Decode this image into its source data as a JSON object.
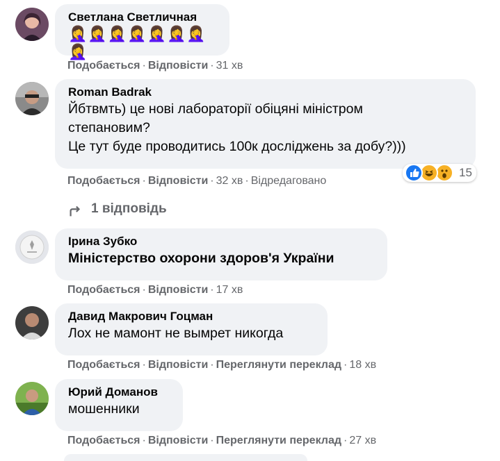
{
  "comments": [
    {
      "author": "Светлана Светличная",
      "text": "🤦‍♀️🤦‍♀️🤦‍♀️🤦‍♀️🤦‍♀️🤦‍♀️🤦‍♀️🤦‍♀️",
      "like": "Подобається",
      "reply": "Відповісти",
      "time": "31 хв"
    },
    {
      "author": "Roman Badrak",
      "text_lines": [
        "Йбтвмть) це нові лабораторії обіцяні міністром",
        "степановим?",
        "Це тут буде проводитись 100к досліджень за добу?)))"
      ],
      "reactions_count": "15",
      "reaction_icons": [
        "like-icon",
        "haha-icon",
        "wow-icon"
      ],
      "like": "Подобається",
      "reply": "Відповісти",
      "time": "32 хв",
      "edited": "Відредаговано",
      "replies_label": "1 відповідь"
    },
    {
      "author": "Ірина Зубко",
      "text": "Міністерство охорони здоров'я України",
      "like": "Подобається",
      "reply": "Відповісти",
      "time": "17 хв"
    },
    {
      "author": "Давид Макрович Гоцман",
      "text": "Лох не мамонт не вымрет никогда",
      "like": "Подобається",
      "reply": "Відповісти",
      "translate": "Переглянути переклад",
      "time": "18 хв"
    },
    {
      "author": "Юрий Доманов",
      "text": "мошенники",
      "like": "Подобається",
      "reply": "Відповісти",
      "translate": "Переглянути переклад",
      "time": "27 хв"
    }
  ],
  "colors": {
    "bubble": "#f0f2f5",
    "meta": "#65676b",
    "like_blue": "#1877f2",
    "haha_yellow": "#f7b125"
  }
}
